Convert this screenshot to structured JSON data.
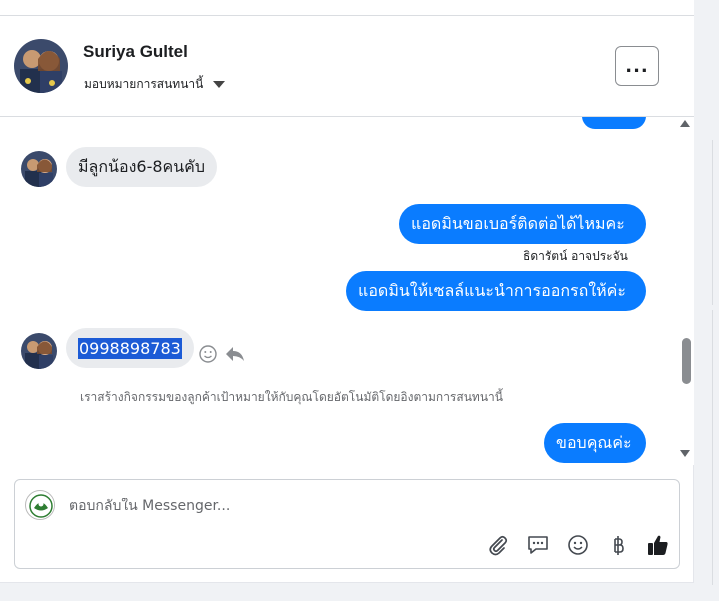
{
  "header": {
    "name": "Suriya Gultel",
    "assign_label": "มอบหมายการสนทนานี้",
    "more_label": "..."
  },
  "messages": {
    "m0_in": "มีลูกน้อง6-8คนคับ",
    "m1_out": "แอดมินขอเบอร์ติดต่อได้ไหมคะ",
    "m2_sender": "ธิดารัตน์ อาจประจัน",
    "m2_out": "แอดมินให้เซลล์แนะนำการออกรถให้ค่ะ",
    "m3_in_phone": "0998898783",
    "notice": "เราสร้างกิจกรรมของลูกค้าเป้าหมายให้กับคุณโดยอัตโนมัติโดยอิงตามการสนทนานี้",
    "m4_out": "ขอบคุณค่ะ"
  },
  "composer": {
    "placeholder": "ตอบกลับใน Messenger..."
  },
  "icons": {
    "attach": "paperclip-icon",
    "comment": "speech-bubble-icon",
    "emoji": "smiley-icon",
    "currency": "baht-icon",
    "like": "thumbs-up-icon",
    "react": "smiley-icon",
    "reply": "reply-arrow-icon"
  },
  "colors": {
    "outgoing_bubble": "#0a7cff",
    "incoming_bubble": "#e9ebee",
    "selection": "#1c5bd6"
  }
}
